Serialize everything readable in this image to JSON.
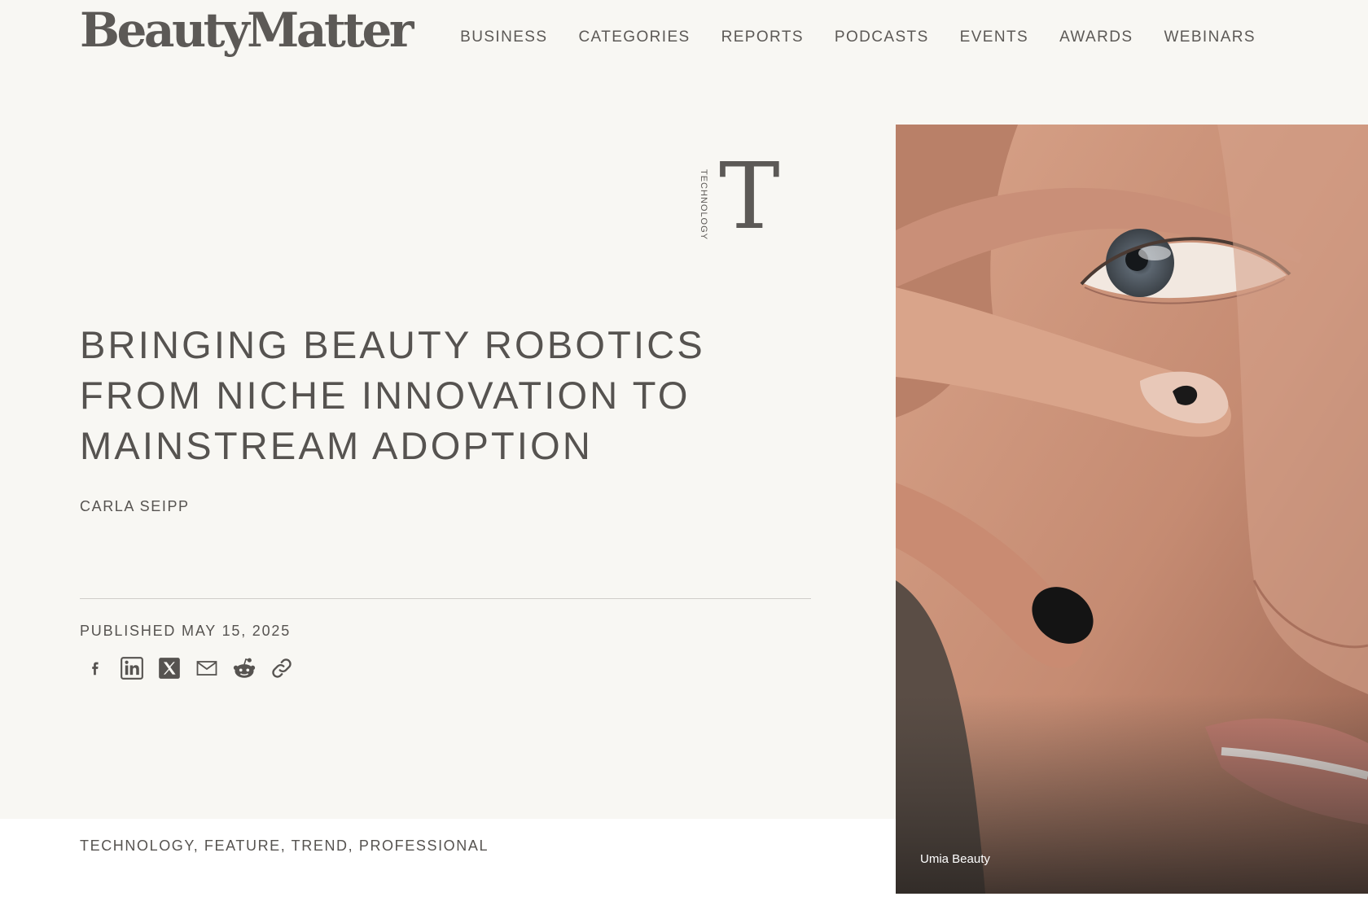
{
  "site": {
    "logo": "BeautyMatter"
  },
  "nav": {
    "items": [
      "BUSINESS",
      "CATEGORIES",
      "REPORTS",
      "PODCASTS",
      "EVENTS",
      "AWARDS",
      "WEBINARS"
    ]
  },
  "article": {
    "category_label": "TECHNOLOGY",
    "category_letter": "T",
    "headline": "BRINGING BEAUTY ROBOTICS FROM NICHE INNOVATION TO MAINSTREAM ADOPTION",
    "author": "CARLA SEIPP",
    "published": "PUBLISHED MAY 15, 2025",
    "tags": "TECHNOLOGY, FEATURE, TREND, PROFESSIONAL"
  },
  "share": {
    "icons": [
      "facebook-icon",
      "linkedin-icon",
      "x-icon",
      "email-icon",
      "reddit-icon",
      "link-icon"
    ]
  },
  "hero": {
    "caption": "Umia Beauty"
  },
  "colors": {
    "page_background": "#f8f7f3",
    "text": "#565350",
    "divider": "#cfcdc9"
  }
}
